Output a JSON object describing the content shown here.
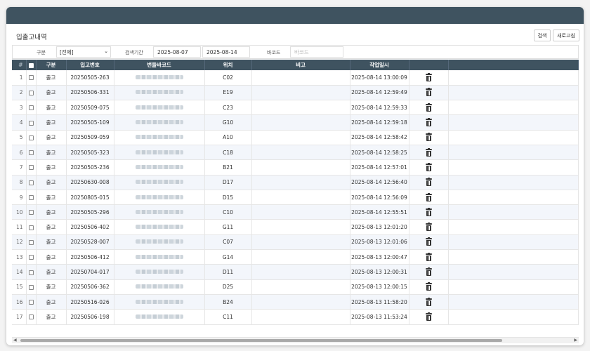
{
  "page": {
    "title": "입출고내역"
  },
  "buttons": {
    "search": "검색",
    "refresh": "새로고침"
  },
  "filter": {
    "type_label": "구분",
    "type_value": "[전체]",
    "period_label": "검색기간",
    "date_from": "2025-08-07",
    "date_to": "2025-08-14",
    "barcode_label": "바코드",
    "barcode_placeholder": "바코드"
  },
  "table": {
    "headers": {
      "num": "#",
      "type": "구분",
      "receipt_no": "입고번호",
      "bundle_barcode": "번들바코드",
      "location": "위치",
      "note": "비고",
      "work_datetime": "작업일시"
    },
    "rows": [
      {
        "num": "1",
        "type": "출고",
        "receipt_no": "20250505-263",
        "location": "C02",
        "note": "",
        "work_datetime": "2025-08-14 13:00:09"
      },
      {
        "num": "2",
        "type": "출고",
        "receipt_no": "20250506-331",
        "location": "E19",
        "note": "",
        "work_datetime": "2025-08-14 12:59:49"
      },
      {
        "num": "3",
        "type": "출고",
        "receipt_no": "20250509-075",
        "location": "C23",
        "note": "",
        "work_datetime": "2025-08-14 12:59:33"
      },
      {
        "num": "4",
        "type": "출고",
        "receipt_no": "20250505-109",
        "location": "G10",
        "note": "",
        "work_datetime": "2025-08-14 12:59:18"
      },
      {
        "num": "5",
        "type": "출고",
        "receipt_no": "20250509-059",
        "location": "A10",
        "note": "",
        "work_datetime": "2025-08-14 12:58:42"
      },
      {
        "num": "6",
        "type": "출고",
        "receipt_no": "20250505-323",
        "location": "C18",
        "note": "",
        "work_datetime": "2025-08-14 12:58:25"
      },
      {
        "num": "7",
        "type": "출고",
        "receipt_no": "20250505-236",
        "location": "B21",
        "note": "",
        "work_datetime": "2025-08-14 12:57:01"
      },
      {
        "num": "8",
        "type": "출고",
        "receipt_no": "20250630-008",
        "location": "D17",
        "note": "",
        "work_datetime": "2025-08-14 12:56:40"
      },
      {
        "num": "9",
        "type": "출고",
        "receipt_no": "20250805-015",
        "location": "D15",
        "note": "",
        "work_datetime": "2025-08-14 12:56:09"
      },
      {
        "num": "10",
        "type": "출고",
        "receipt_no": "20250505-296",
        "location": "C10",
        "note": "",
        "work_datetime": "2025-08-14 12:55:51"
      },
      {
        "num": "11",
        "type": "출고",
        "receipt_no": "20250506-402",
        "location": "G11",
        "note": "",
        "work_datetime": "2025-08-13 12:01:20"
      },
      {
        "num": "12",
        "type": "출고",
        "receipt_no": "20250528-007",
        "location": "C07",
        "note": "",
        "work_datetime": "2025-08-13 12:01:06"
      },
      {
        "num": "13",
        "type": "출고",
        "receipt_no": "20250506-412",
        "location": "G14",
        "note": "",
        "work_datetime": "2025-08-13 12:00:47"
      },
      {
        "num": "14",
        "type": "출고",
        "receipt_no": "20250704-017",
        "location": "D11",
        "note": "",
        "work_datetime": "2025-08-13 12:00:31"
      },
      {
        "num": "15",
        "type": "출고",
        "receipt_no": "20250506-362",
        "location": "D25",
        "note": "",
        "work_datetime": "2025-08-13 12:00:15"
      },
      {
        "num": "16",
        "type": "출고",
        "receipt_no": "20250516-026",
        "location": "B24",
        "note": "",
        "work_datetime": "2025-08-13 11:58:20"
      },
      {
        "num": "17",
        "type": "출고",
        "receipt_no": "20250506-198",
        "location": "C11",
        "note": "",
        "work_datetime": "2025-08-13 11:53:24"
      }
    ]
  },
  "icons": {
    "row_action": "trash-icon",
    "header_checkbox": "checkbox-icon"
  },
  "colors": {
    "header_bg": "#3f5360",
    "titlebar_bg": "#3f5360",
    "row_alt_bg": "#f3f6fb"
  }
}
